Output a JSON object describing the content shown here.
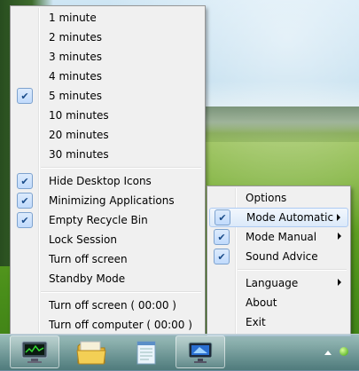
{
  "main_menu": {
    "items": [
      {
        "label": "1 minute",
        "checked": false
      },
      {
        "label": "2 minutes",
        "checked": false
      },
      {
        "label": "3 minutes",
        "checked": false
      },
      {
        "label": "4 minutes",
        "checked": false
      },
      {
        "label": "5 minutes",
        "checked": true
      },
      {
        "label": "10 minutes",
        "checked": false
      },
      {
        "label": "20 minutes",
        "checked": false
      },
      {
        "label": "30 minutes",
        "checked": false
      },
      {
        "label": "Hide Desktop Icons",
        "checked": true
      },
      {
        "label": "Minimizing Applications",
        "checked": true
      },
      {
        "label": "Empty Recycle Bin",
        "checked": true
      },
      {
        "label": "Lock Session",
        "checked": false
      },
      {
        "label": "Turn off screen",
        "checked": false
      },
      {
        "label": "Standby Mode",
        "checked": false
      },
      {
        "label": "Turn off screen  ( 00:00 )",
        "checked": false
      },
      {
        "label": "Turn off computer  ( 00:00 )",
        "checked": false
      }
    ]
  },
  "tray_menu": {
    "items": [
      {
        "label": "Options",
        "checked": false,
        "submenu": false
      },
      {
        "label": "Mode Automatic",
        "checked": true,
        "submenu": true,
        "highlighted": true
      },
      {
        "label": "Mode Manual",
        "checked": true,
        "submenu": true
      },
      {
        "label": "Sound Advice",
        "checked": true,
        "submenu": false
      },
      {
        "label": "Language",
        "checked": false,
        "submenu": true
      },
      {
        "label": "About",
        "checked": false,
        "submenu": false
      },
      {
        "label": "Exit",
        "checked": false,
        "submenu": false
      }
    ]
  },
  "check_glyph": "✔",
  "icons": {
    "taskbar": [
      "task-manager-icon",
      "folder-icon",
      "notepad-icon",
      "monitor-app-icon"
    ],
    "tray": [
      "show-hidden-icons-icon",
      "status-green-icon"
    ]
  },
  "colors": {
    "menu_bg": "#f0f0f0",
    "highlight_border": "#aecbf2",
    "check_box": "#c1dbfc"
  }
}
